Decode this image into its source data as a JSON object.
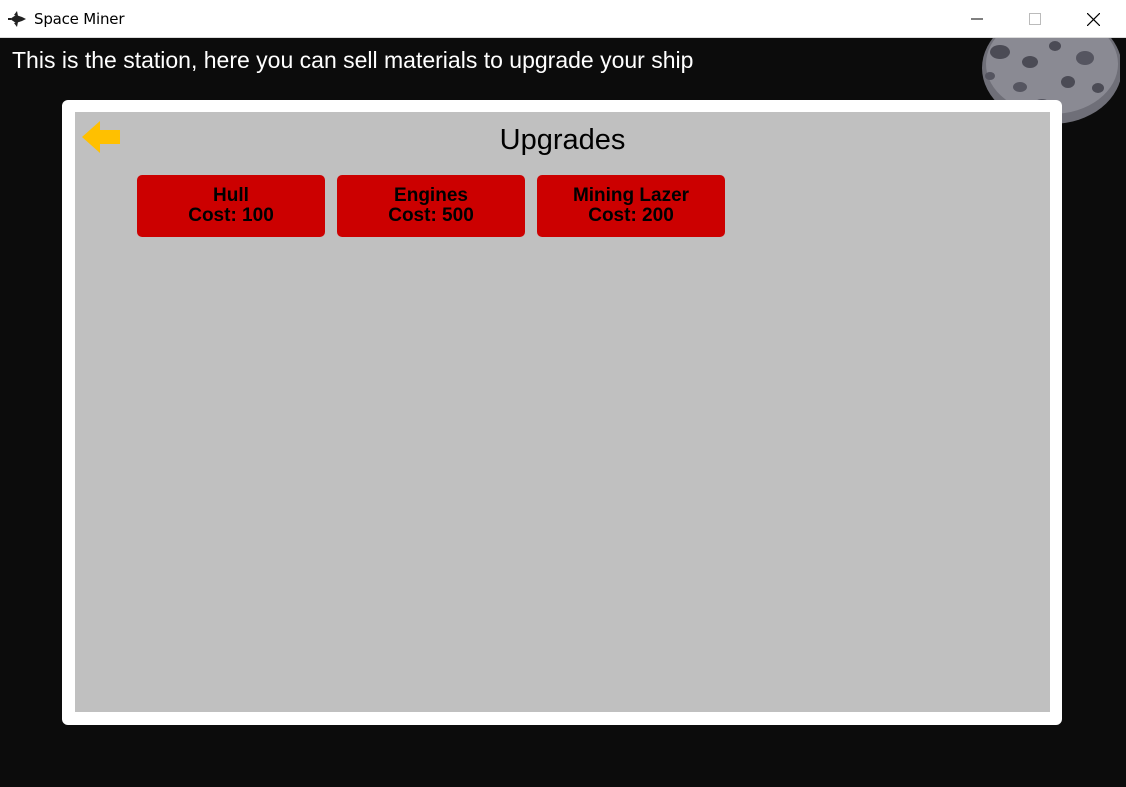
{
  "window": {
    "title": "Space Miner"
  },
  "station": {
    "message": "This is the station, here you can sell materials to upgrade your ship"
  },
  "panel": {
    "title": "Upgrades",
    "upgrades": [
      {
        "name": "Hull",
        "cost_label": "Cost: 100"
      },
      {
        "name": "Engines",
        "cost_label": "Cost: 500"
      },
      {
        "name": "Mining Lazer",
        "cost_label": "Cost: 200"
      }
    ]
  },
  "colors": {
    "background": "#0c0c0c",
    "panel_frame": "#ffffff",
    "panel_fill": "#c0c0c0",
    "upgrade_button": "#cc0000",
    "back_arrow": "#ffc000"
  }
}
